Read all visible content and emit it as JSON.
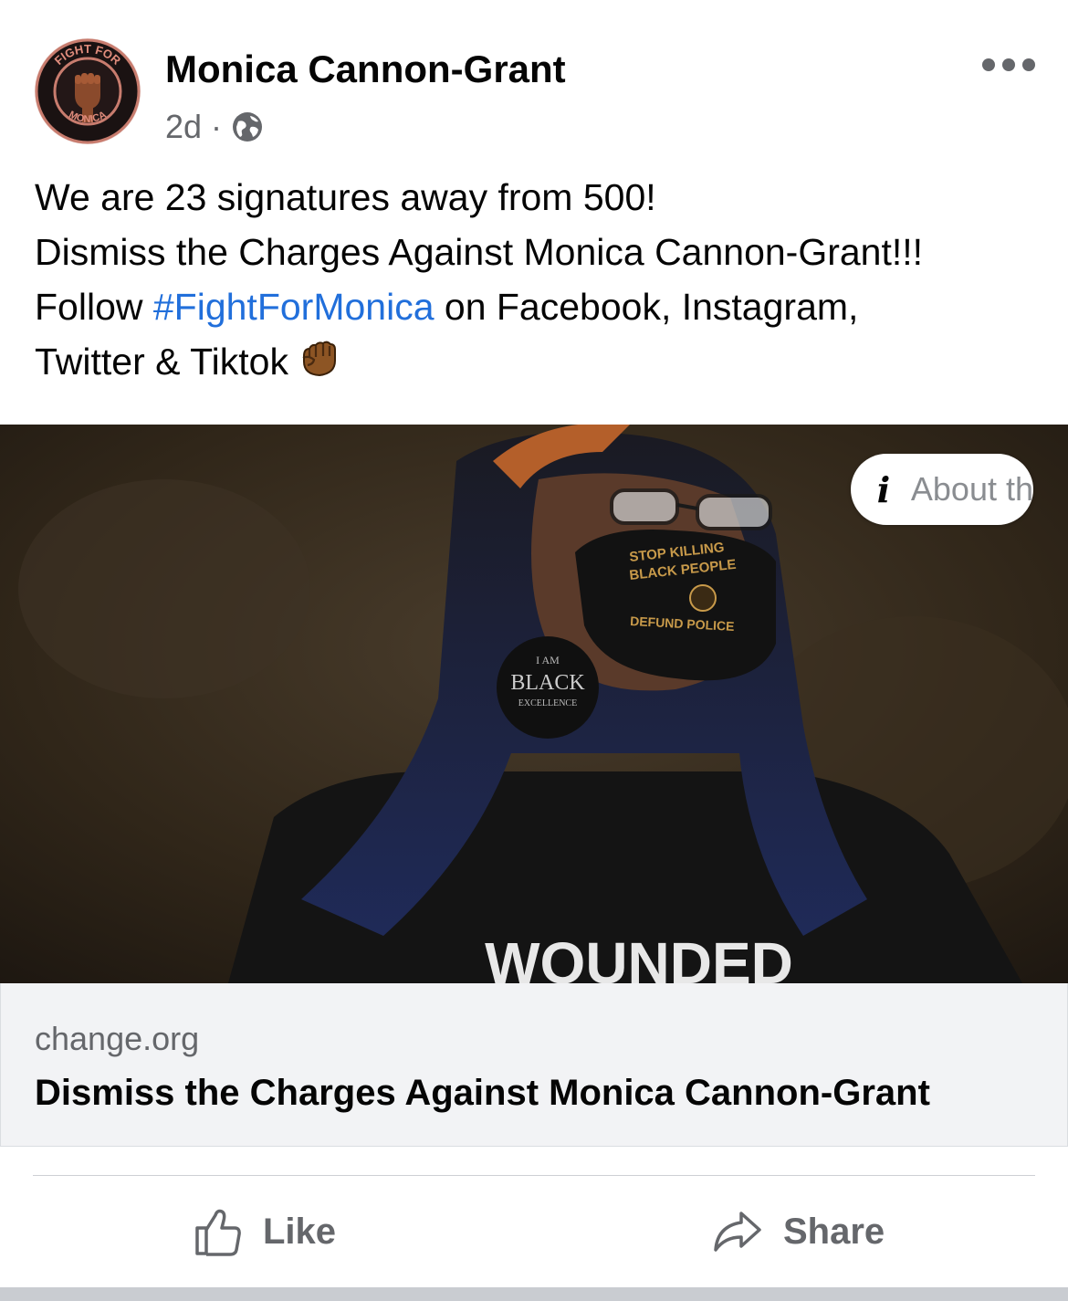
{
  "post": {
    "author": "Monica Cannon-Grant",
    "time": "2d",
    "separator": "·",
    "privacy_icon": "globe-icon",
    "avatar_text_top": "FIGHT FOR",
    "avatar_text_bottom": "MONICA",
    "text_lines": [
      "We are 23 signatures away from 500!",
      "Dismiss the Charges Against Monica Cannon-Grant!!!"
    ],
    "follow_prefix": "Follow ",
    "hashtag": "#FightForMonica",
    "follow_suffix": " on Facebook, Instagram,",
    "last_line": "Twitter & Tiktok",
    "emoji_icon": "raised-fist-icon"
  },
  "image": {
    "mask_line1": "STOP KILLING",
    "mask_line2": "BLACK PEOPLE",
    "mask_line3": "DEFUND POLICE",
    "earring_line1": "I AM",
    "earring_line2": "BLACK",
    "earring_line3": "EXCELLENCE",
    "shirt_text": "WOUNDED",
    "about_icon": "info-icon",
    "about_label": "About th"
  },
  "link_card": {
    "domain": "change.org",
    "title": "Dismiss the Charges Against Monica Cannon-Grant"
  },
  "actions": {
    "like_label": "Like",
    "share_label": "Share"
  },
  "colors": {
    "hashtag": "#216fdb",
    "secondary_text": "#65676b",
    "card_bg": "#f2f3f5"
  }
}
